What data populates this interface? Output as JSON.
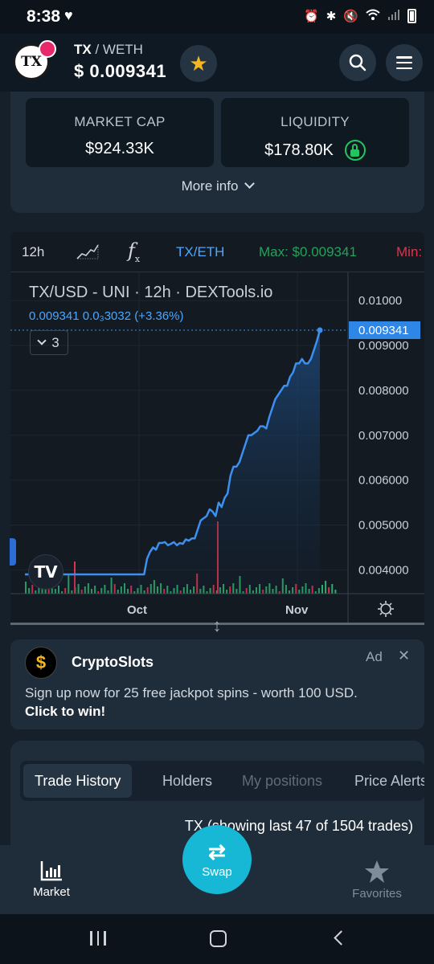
{
  "status_bar": {
    "time": "8:38",
    "heart": "♥"
  },
  "header": {
    "logo_text": "TX",
    "pair_base": "TX",
    "pair_separator": " / ",
    "pair_quote": "WETH",
    "price": "$ 0.009341",
    "star_icon": "star-icon",
    "star_color": "#f4b81e"
  },
  "stats": {
    "market_cap_label": "MARKET CAP",
    "market_cap_value": "$924.33K",
    "liquidity_label": "LIQUIDITY",
    "liquidity_value": "$178.80K",
    "liquidity_locked_color": "#22c55e",
    "more_info": "More info"
  },
  "chart_toolbar": {
    "interval": "12h",
    "fx": "f",
    "pair": "TX/ETH",
    "max": "Max: $0.009341",
    "min": "Min:"
  },
  "chart_header": {
    "title": "TX/USD - UNI · 12h · DEXTools.io",
    "legend": "0.009341  0.0₃3032 (+3.36%)",
    "collapse_count": "3",
    "tv_logo": "TV"
  },
  "chart_data": {
    "type": "line",
    "title": "TX/USD - UNI · 12h · DEXTools.io",
    "line_color": "#3d8ff0",
    "y_ticks": [
      "0.004000",
      "0.005000",
      "0.006000",
      "0.007000",
      "0.008000",
      "0.009000",
      "0.01000"
    ],
    "y_tick_values": [
      0.004,
      0.005,
      0.006,
      0.007,
      0.008,
      0.009,
      0.01
    ],
    "ylim": [
      0.00347,
      0.01063
    ],
    "x_ticks": [
      "Oct",
      "Nov"
    ],
    "current_price_label": "0.009341",
    "current_price": 0.009341,
    "series": [
      {
        "values": [
          0.0039,
          0.0039,
          0.0039,
          0.0039,
          0.0039,
          0.0039,
          0.0039,
          0.0039,
          0.0039,
          0.0039,
          0.0039,
          0.0039,
          0.0039,
          0.0039,
          0.0039,
          0.0039,
          0.0039,
          0.0039,
          0.0039,
          0.0039,
          0.0039,
          0.0039,
          0.0039,
          0.0039,
          0.0039,
          0.0039,
          0.0039,
          0.0039,
          0.0039,
          0.0039,
          0.0039,
          0.0039,
          0.0039,
          0.0039,
          0.0039,
          0.0039,
          0.0039,
          0.0039,
          0.0039,
          0.0039,
          0.0039,
          0.00425,
          0.0044,
          0.0045,
          0.00445,
          0.0046,
          0.0046,
          0.00462,
          0.00455,
          0.00458,
          0.00462,
          0.00455,
          0.0046,
          0.00458,
          0.00468,
          0.00465,
          0.0047,
          0.0047,
          0.0049,
          0.0051,
          0.00515,
          0.0052,
          0.00535,
          0.0053,
          0.0052,
          0.0055,
          0.0054,
          0.0056,
          0.0057,
          0.0061,
          0.0063,
          0.0063,
          0.0064,
          0.0066,
          0.0068,
          0.007,
          0.007,
          0.00705,
          0.0071,
          0.0072,
          0.0072,
          0.00715,
          0.0074,
          0.0076,
          0.0078,
          0.0079,
          0.008,
          0.0081,
          0.0081,
          0.0083,
          0.0084,
          0.0086,
          0.0086,
          0.0087,
          0.0086,
          0.0086,
          0.0087,
          0.0089,
          0.0091,
          0.009341
        ]
      }
    ],
    "volume_colors": {
      "up": "#2eae6a",
      "down": "#e0334a"
    }
  },
  "ad": {
    "logo": "$",
    "name": "CryptoSlots",
    "tag": "Ad",
    "close": "✕",
    "text": "Sign up now for 25 free jackpot spins - worth 100 USD.",
    "cta": "Click to win!"
  },
  "trades": {
    "tabs": [
      "Trade History",
      "Holders",
      "My positions",
      "Price Alerts"
    ],
    "info": "TX (showing last 47 of 1504 trades)"
  },
  "bottom_nav": {
    "market": "Market",
    "swap": "Swap",
    "favorites": "Favorites",
    "swap_color": "#16b8d6"
  }
}
